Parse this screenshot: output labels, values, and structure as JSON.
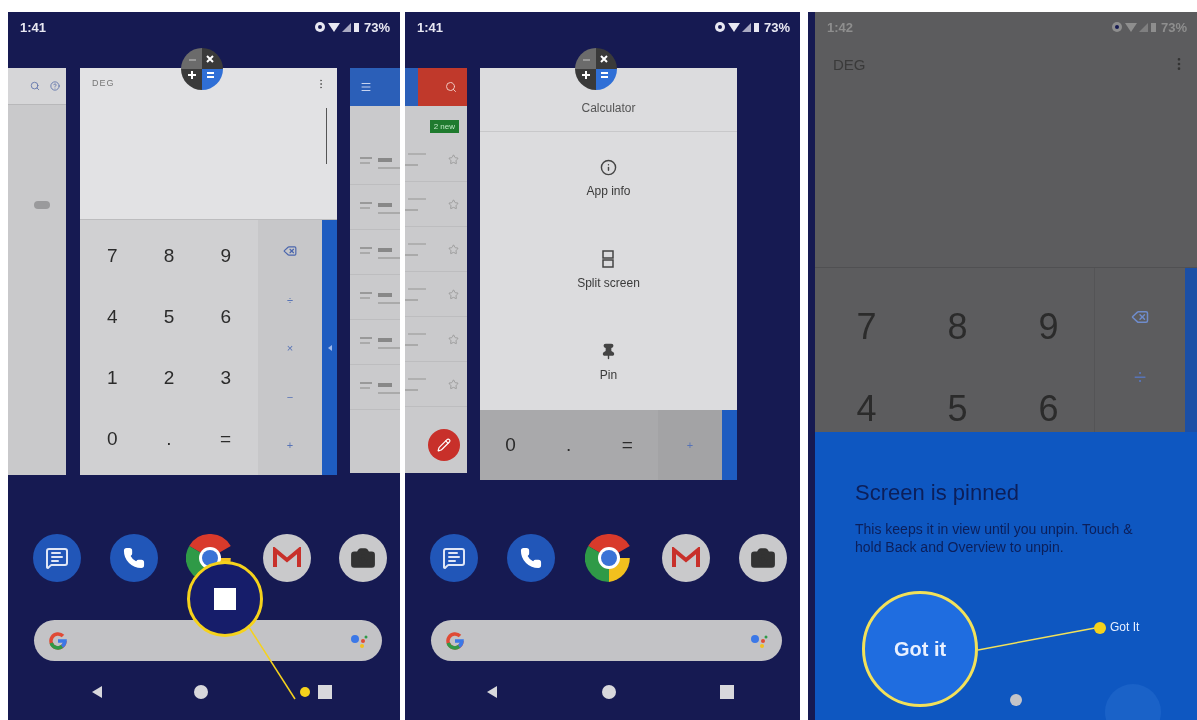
{
  "overview_screen": {
    "status": {
      "time": "1:41",
      "battery": "73%"
    },
    "calculator_card": {
      "mode": "DEG",
      "digit_rows": [
        [
          "7",
          "8",
          "9"
        ],
        [
          "4",
          "5",
          "6"
        ],
        [
          "1",
          "2",
          "3"
        ],
        [
          "0",
          ".",
          "="
        ]
      ],
      "operators": [
        "÷",
        "×",
        "−",
        "+"
      ]
    },
    "settings_card": {
      "toggle_on": false
    },
    "dock": [
      {
        "kind": "messages"
      },
      {
        "kind": "phone"
      },
      {
        "kind": "chrome"
      },
      {
        "kind": "gmail"
      },
      {
        "kind": "camera"
      }
    ],
    "nav": [
      {
        "kind": "back",
        "highlighted": false
      },
      {
        "kind": "home",
        "highlighted": false
      },
      {
        "kind": "recents",
        "highlighted": true
      }
    ]
  },
  "menu_screen": {
    "status": {
      "time": "1:41",
      "battery": "73%"
    },
    "mail_card": {
      "badge": "2 new"
    },
    "menu_card": {
      "title": "Calculator",
      "items": [
        {
          "kind": "info",
          "label": "App info"
        },
        {
          "kind": "split",
          "label": "Split screen"
        },
        {
          "kind": "pin",
          "label": "Pin"
        }
      ],
      "keys": [
        "0",
        ".",
        "="
      ],
      "operator": "+"
    },
    "dock": [
      {
        "kind": "messages"
      },
      {
        "kind": "phone"
      },
      {
        "kind": "chrome"
      },
      {
        "kind": "gmail"
      },
      {
        "kind": "camera"
      }
    ],
    "nav": [
      {
        "kind": "back"
      },
      {
        "kind": "home"
      },
      {
        "kind": "recents"
      }
    ]
  },
  "pinned_screen": {
    "status": {
      "time": "1:42",
      "battery": "73%"
    },
    "calculator": {
      "mode": "DEG",
      "digit_rows": [
        [
          "7",
          "8",
          "9"
        ],
        [
          "4",
          "5",
          "6"
        ]
      ],
      "operators": [
        "÷"
      ]
    },
    "dialog": {
      "title": "Screen is pinned",
      "body": "This keeps it in view until you unpin. Touch & hold Back and Overview to unpin.",
      "button": "Got it",
      "callout_label": "Got It"
    }
  }
}
